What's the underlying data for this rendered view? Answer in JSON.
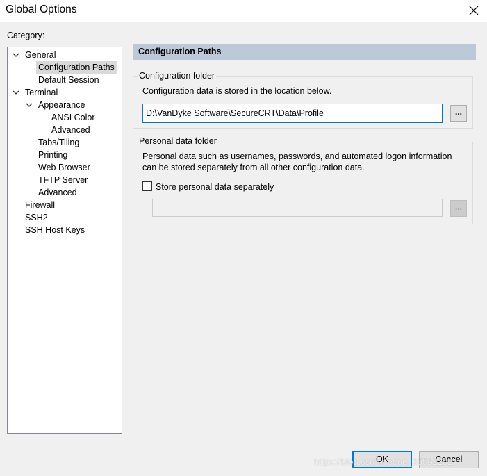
{
  "window": {
    "title": "Global Options",
    "close_glyph": "✕"
  },
  "category_label": "Category:",
  "tree": {
    "general": "General",
    "configuration_paths": "Configuration Paths",
    "default_session": "Default Session",
    "terminal": "Terminal",
    "appearance": "Appearance",
    "ansi_color": "ANSI Color",
    "advanced_appearance": "Advanced",
    "tabs_tiling": "Tabs/Tiling",
    "printing": "Printing",
    "web_browser": "Web Browser",
    "tftp_server": "TFTP Server",
    "advanced_terminal": "Advanced",
    "firewall": "Firewall",
    "ssh2": "SSH2",
    "ssh_host_keys": "SSH Host Keys",
    "selected": "Configuration Paths"
  },
  "panel": {
    "header": "Configuration Paths",
    "config_folder": {
      "legend": "Configuration folder",
      "description": "Configuration data is stored in the location below.",
      "path_value": "D:\\VanDyke Software\\SecureCRT\\Data\\Profile",
      "browse_label": "..."
    },
    "personal_folder": {
      "legend": "Personal data folder",
      "description_line1": "Personal data such as usernames, passwords, and automated logon information",
      "description_line2": "can be stored separately from all other configuration data.",
      "checkbox_label": "Store personal data separately",
      "checkbox_checked": false,
      "path_value": "",
      "browse_label": "..."
    }
  },
  "buttons": {
    "ok": "OK",
    "cancel": "Cancel"
  },
  "watermark": "https://blog.csdn.net/qq_35562201",
  "colors": {
    "accent": "#0078d7",
    "header_bg": "#bccad8",
    "selection": "#d9d9d9"
  }
}
